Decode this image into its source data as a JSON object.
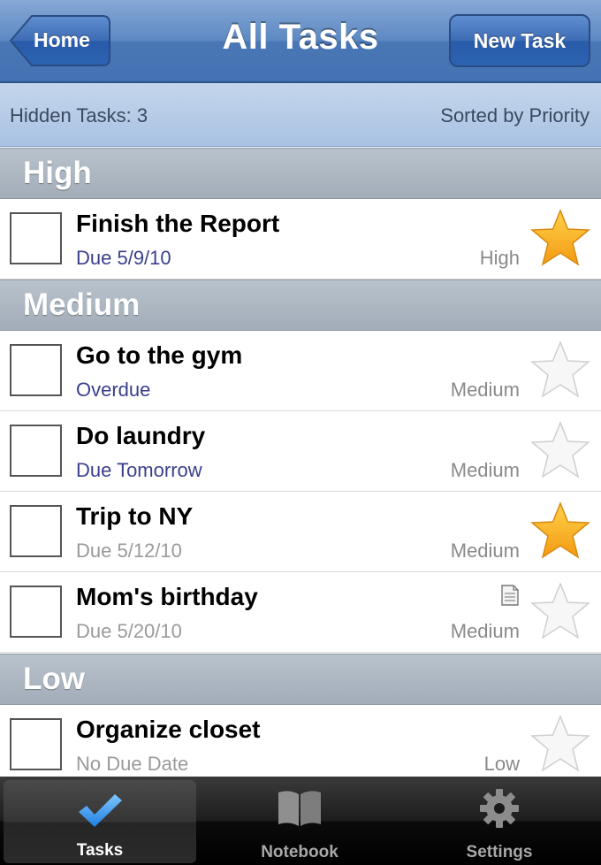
{
  "navbar": {
    "title": "All Tasks",
    "back_label": "Home",
    "new_task_label": "New Task"
  },
  "infobar": {
    "hidden_tasks": "Hidden Tasks: 3",
    "sort_label": "Sorted by Priority"
  },
  "sections": {
    "high": "High",
    "medium": "Medium",
    "low": "Low"
  },
  "tasks": [
    {
      "title": "Finish the Report",
      "due": "Due 5/9/10",
      "priority": "High",
      "starred": true,
      "has_note": false,
      "due_color": "#3a3f8d"
    },
    {
      "title": "Go to the gym",
      "due": "Overdue",
      "priority": "Medium",
      "starred": false,
      "has_note": false,
      "due_color": "#3a3f8d"
    },
    {
      "title": "Do laundry",
      "due": "Due Tomorrow",
      "priority": "Medium",
      "starred": false,
      "has_note": false,
      "due_color": "#3a3f8d"
    },
    {
      "title": "Trip to NY",
      "due": "Due 5/12/10",
      "priority": "Medium",
      "starred": true,
      "has_note": false,
      "due_color": "#9a9a9a"
    },
    {
      "title": "Mom's birthday",
      "due": "Due 5/20/10",
      "priority": "Medium",
      "starred": false,
      "has_note": true,
      "due_color": "#9a9a9a"
    },
    {
      "title": "Organize closet",
      "due": "No Due Date",
      "priority": "Low",
      "starred": false,
      "has_note": false,
      "due_color": "#9a9a9a"
    }
  ],
  "tabbar": {
    "tasks": "Tasks",
    "notebook": "Notebook",
    "settings": "Settings",
    "active": "tasks"
  },
  "colors": {
    "navbar_blue": "#4a77b5",
    "star_gold": "#f7a51c",
    "due_blue": "#3a3f8d"
  },
  "icons": [
    "back-arrow-icon",
    "star-filled-icon",
    "star-empty-icon",
    "note-icon",
    "checkmark-icon",
    "notebook-icon",
    "gear-icon"
  ]
}
